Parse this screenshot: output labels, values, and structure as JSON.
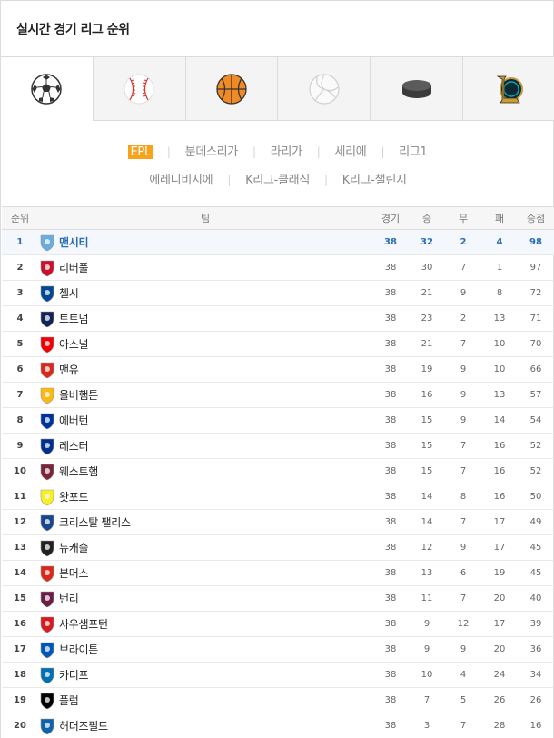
{
  "header": {
    "title": "실시간 경기 리그 순위"
  },
  "sport_tabs": [
    {
      "icon": "soccer-ball-icon",
      "active": true
    },
    {
      "icon": "baseball-icon",
      "active": false
    },
    {
      "icon": "basketball-icon",
      "active": false
    },
    {
      "icon": "volleyball-icon",
      "active": false
    },
    {
      "icon": "hockey-puck-icon",
      "active": false
    },
    {
      "icon": "lol-logo-icon",
      "active": false
    }
  ],
  "leagues": {
    "row1": [
      "EPL",
      "분데스리가",
      "라리가",
      "세리에",
      "리그1"
    ],
    "row2": [
      "에레디비지에",
      "K리그-클래식",
      "K리그-챌린지"
    ],
    "active": "EPL"
  },
  "table": {
    "headers": {
      "rank": "순위",
      "team": "팀",
      "played": "경기",
      "win": "승",
      "draw": "무",
      "loss": "패",
      "points": "승점"
    },
    "rows": [
      {
        "rank": "1",
        "team": "맨시티",
        "played": "38",
        "win": "32",
        "draw": "2",
        "loss": "4",
        "points": "98",
        "color": "#6cabdd"
      },
      {
        "rank": "2",
        "team": "리버풀",
        "played": "38",
        "win": "30",
        "draw": "7",
        "loss": "1",
        "points": "97",
        "color": "#c8102e"
      },
      {
        "rank": "3",
        "team": "첼시",
        "played": "38",
        "win": "21",
        "draw": "9",
        "loss": "8",
        "points": "72",
        "color": "#034694"
      },
      {
        "rank": "4",
        "team": "토트넘",
        "played": "38",
        "win": "23",
        "draw": "2",
        "loss": "13",
        "points": "71",
        "color": "#132257"
      },
      {
        "rank": "5",
        "team": "아스널",
        "played": "38",
        "win": "21",
        "draw": "7",
        "loss": "10",
        "points": "70",
        "color": "#ef0107"
      },
      {
        "rank": "6",
        "team": "맨유",
        "played": "38",
        "win": "19",
        "draw": "9",
        "loss": "10",
        "points": "66",
        "color": "#da291c"
      },
      {
        "rank": "7",
        "team": "울버햄튼",
        "played": "38",
        "win": "16",
        "draw": "9",
        "loss": "13",
        "points": "57",
        "color": "#fdb913"
      },
      {
        "rank": "8",
        "team": "에버턴",
        "played": "38",
        "win": "15",
        "draw": "9",
        "loss": "14",
        "points": "54",
        "color": "#003399"
      },
      {
        "rank": "9",
        "team": "레스터",
        "played": "38",
        "win": "15",
        "draw": "7",
        "loss": "16",
        "points": "52",
        "color": "#003090"
      },
      {
        "rank": "10",
        "team": "웨스트햄",
        "played": "38",
        "win": "15",
        "draw": "7",
        "loss": "16",
        "points": "52",
        "color": "#7a263a"
      },
      {
        "rank": "11",
        "team": "왓포드",
        "played": "38",
        "win": "14",
        "draw": "8",
        "loss": "16",
        "points": "50",
        "color": "#fbee23"
      },
      {
        "rank": "12",
        "team": "크리스탈 팰리스",
        "played": "38",
        "win": "14",
        "draw": "7",
        "loss": "17",
        "points": "49",
        "color": "#1b458f"
      },
      {
        "rank": "13",
        "team": "뉴캐슬",
        "played": "38",
        "win": "12",
        "draw": "9",
        "loss": "17",
        "points": "45",
        "color": "#241f20"
      },
      {
        "rank": "14",
        "team": "본머스",
        "played": "38",
        "win": "13",
        "draw": "6",
        "loss": "19",
        "points": "45",
        "color": "#da291c"
      },
      {
        "rank": "15",
        "team": "번리",
        "played": "38",
        "win": "11",
        "draw": "7",
        "loss": "20",
        "points": "40",
        "color": "#6c1d45"
      },
      {
        "rank": "16",
        "team": "사우샘프턴",
        "played": "38",
        "win": "9",
        "draw": "12",
        "loss": "17",
        "points": "39",
        "color": "#d71920"
      },
      {
        "rank": "17",
        "team": "브라이튼",
        "played": "38",
        "win": "9",
        "draw": "9",
        "loss": "20",
        "points": "36",
        "color": "#0057b8"
      },
      {
        "rank": "18",
        "team": "카디프",
        "played": "38",
        "win": "10",
        "draw": "4",
        "loss": "24",
        "points": "34",
        "color": "#0070b5"
      },
      {
        "rank": "19",
        "team": "풀럼",
        "played": "38",
        "win": "7",
        "draw": "5",
        "loss": "26",
        "points": "26",
        "color": "#000000"
      },
      {
        "rank": "20",
        "team": "허더즈필드",
        "played": "38",
        "win": "3",
        "draw": "7",
        "loss": "28",
        "points": "16",
        "color": "#0e63ad"
      }
    ]
  }
}
